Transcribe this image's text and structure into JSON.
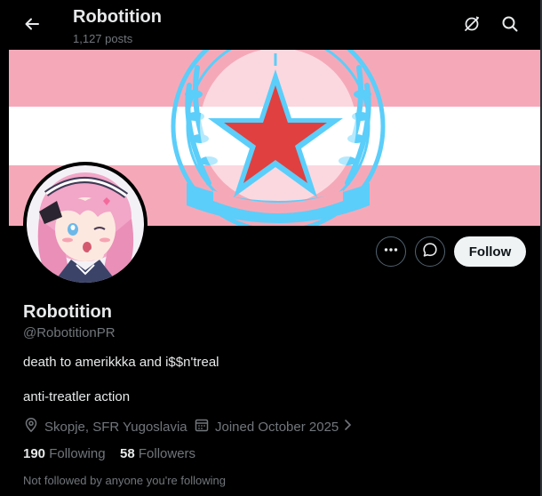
{
  "header": {
    "title": "Robotition",
    "posts_count": "1,127 posts"
  },
  "actions": {
    "follow_label": "Follow"
  },
  "profile": {
    "display_name": "Robotition",
    "handle": "@RobotitionPR",
    "bio_line1": "death to amerikkka and i$$n'treal",
    "bio_line2": "anti-treatler action",
    "location": "Skopje, SFR Yugoslavia",
    "joined": "Joined October 2025",
    "following_count": "190",
    "following_label": "Following",
    "followers_count": "58",
    "followers_label": "Followers",
    "not_followed_text": "Not followed by anyone you're following"
  },
  "icons": {
    "back": "arrow-left-icon",
    "grok": "grok-icon",
    "search": "search-icon",
    "more": "more-icon",
    "message": "message-icon",
    "location": "location-pin-icon",
    "calendar": "calendar-icon",
    "chevron": "chevron-right-icon"
  },
  "colors": {
    "background": "#000000",
    "text_primary": "#e7e9ea",
    "text_secondary": "#71767b",
    "banner_pink": "#f5a9b8",
    "banner_white": "#ffffff",
    "banner_blue": "#5bcefa",
    "star_red": "#e0403f",
    "follow_bg": "#eff3f4"
  }
}
